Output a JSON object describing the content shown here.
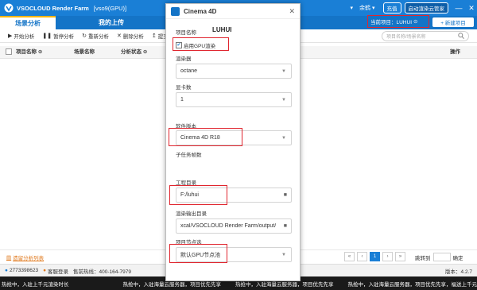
{
  "titlebar": {
    "app_name": "VSOCLOUD Render Farm",
    "project_label": "[vso9(GPU)]",
    "user_name": "余鹤",
    "badge_recharge": "充值",
    "badge_manager": "启动渲染云管家",
    "minimize": "—",
    "close": "✕"
  },
  "tabs": [
    {
      "label": "场景分析"
    },
    {
      "label": "我的上传"
    }
  ],
  "current_project": {
    "label": "当前项目：LUHUI"
  },
  "new_project_label": "+ 新建项目",
  "toolbar": {
    "start": "开始分析",
    "pause": "暂停分析",
    "restart": "重新分析",
    "delete": "删除分析",
    "submit": "提交"
  },
  "search": {
    "placeholder": "项目名称/场景名称"
  },
  "table": {
    "headers": [
      "项目名称",
      "场景名称",
      "分析状态",
      "操作"
    ]
  },
  "bottom": {
    "alloc_link": "遗留分析列表",
    "pages": [
      "«",
      "‹",
      "1",
      "›",
      "»"
    ],
    "jump_label": "跳转到",
    "confirm": "确定"
  },
  "status": {
    "qq": "2773398623",
    "login": "客服登录",
    "phone": "售前热线：400-164-7979",
    "version": "版本：4.2.7"
  },
  "ticker": [
    "热抢中，入驻上千元渲染时长",
    "热抢中，入驻海量云服务器，项目优先先享",
    "热抢中，入驻海量云服务器，项目优先先享",
    "热抢中，入驻海量云服务器，项目优先先享，福送上千元渲染"
  ],
  "dialog": {
    "title": "Cinema 4D",
    "project_name_label": "项目名称",
    "project_name_value": "LUHUI",
    "gpu_render_label": "启用GPU渲染",
    "renderer_label": "渲染器",
    "renderer_value": "octane",
    "gpu_count_label": "显卡数",
    "gpu_count_value": "1",
    "software_label": "软件版本",
    "software_value": "Cinema 4D R18",
    "subtask_label": "子任务帧数",
    "project_dir_label": "工程目录",
    "project_dir_value": "F:/luhui",
    "output_dir_label": "渲染输出目录",
    "output_dir_value": "xcal/VSOCLOUD Render Farm/output/",
    "node_label": "项目节点选",
    "node_value": "默认GPU节点池"
  },
  "colors": {
    "title_blue": "#1a7fd6",
    "tab_blue": "#1474c7",
    "highlight_red": "#e0262f",
    "link_orange": "#e07a1f",
    "tab_accent": "#ffb400"
  }
}
